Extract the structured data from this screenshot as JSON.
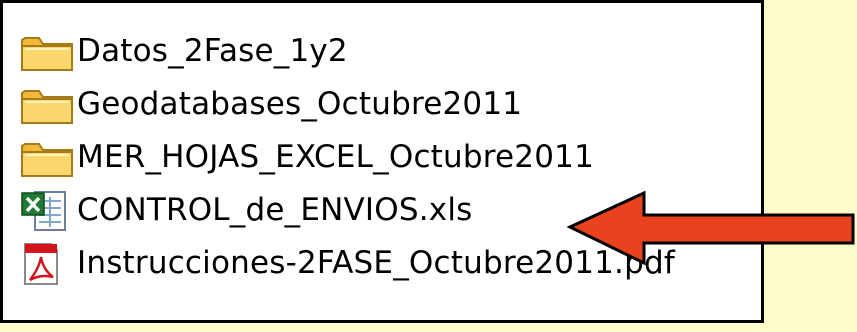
{
  "explorer": {
    "items": [
      {
        "name": "Datos_2Fase_1y2",
        "icon": "folder-icon"
      },
      {
        "name": "Geodatabases_Octubre2011",
        "icon": "folder-icon"
      },
      {
        "name": "MER_HOJAS_EXCEL_Octubre2011",
        "icon": "folder-icon"
      },
      {
        "name": "CONTROL_de_ENVIOS.xls",
        "icon": "excel-file-icon"
      },
      {
        "name": "Instrucciones-2FASE_Octubre2011.pdf",
        "icon": "pdf-file-icon"
      }
    ]
  },
  "annotation": {
    "icon": "red-arrow-icon",
    "points_to": "CONTROL_de_ENVIOS.xls",
    "color": "#e8421e"
  },
  "colors": {
    "background": "#fffccc",
    "panel": "#ffffff",
    "folder": "#f5c64a"
  }
}
